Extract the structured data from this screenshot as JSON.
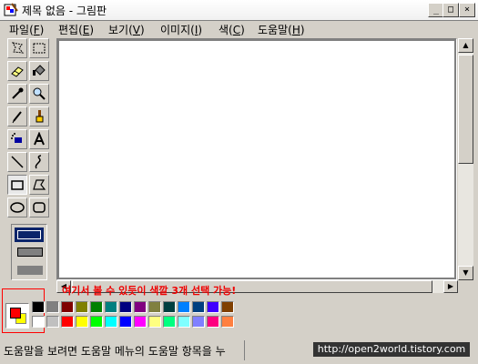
{
  "window": {
    "title": "제목 없음 - 그림판",
    "controls": [
      "_",
      "□",
      "×"
    ]
  },
  "menu": [
    {
      "label": "파일(",
      "key": "F",
      "end": ")"
    },
    {
      "label": "편집(",
      "key": "E",
      "end": ")"
    },
    {
      "label": "보기(",
      "key": "V",
      "end": ")"
    },
    {
      "label": "이미지(",
      "key": "I",
      "end": ")"
    },
    {
      "label": "색(",
      "key": "C",
      "end": ")"
    },
    {
      "label": "도움말(",
      "key": "H",
      "end": ")"
    }
  ],
  "tools": [
    "free-form-select-icon",
    "select-icon",
    "eraser-icon",
    "fill-icon",
    "pick-color-icon",
    "magnifier-icon",
    "pencil-icon",
    "brush-icon",
    "airbrush-icon",
    "text-icon",
    "line-icon",
    "curve-icon",
    "rectangle-icon",
    "polygon-icon",
    "ellipse-icon",
    "rounded-rectangle-icon"
  ],
  "active_tool": "rectangle-icon",
  "annotation": "여기서 볼 수 있듯이 색깔 3개 선택 가능!",
  "current_colors": {
    "foreground": "#ff0000",
    "background": "#ffff00"
  },
  "palette_top": [
    "#000000",
    "#808080",
    "#800000",
    "#808000",
    "#008000",
    "#008080",
    "#000080",
    "#800080",
    "#808040",
    "#004040",
    "#0080ff",
    "#004080",
    "#4000ff",
    "#804000"
  ],
  "palette_bottom": [
    "#ffffff",
    "#c0c0c0",
    "#ff0000",
    "#ffff00",
    "#00ff00",
    "#00ffff",
    "#0000ff",
    "#ff00ff",
    "#ffff80",
    "#00ff80",
    "#80ffff",
    "#8080ff",
    "#ff0080",
    "#ff8040"
  ],
  "status": {
    "help": "도움말을 보려면 도움말 메뉴의 도움말 항목을 누",
    "watermark": "http://open2world.tistory.com"
  }
}
